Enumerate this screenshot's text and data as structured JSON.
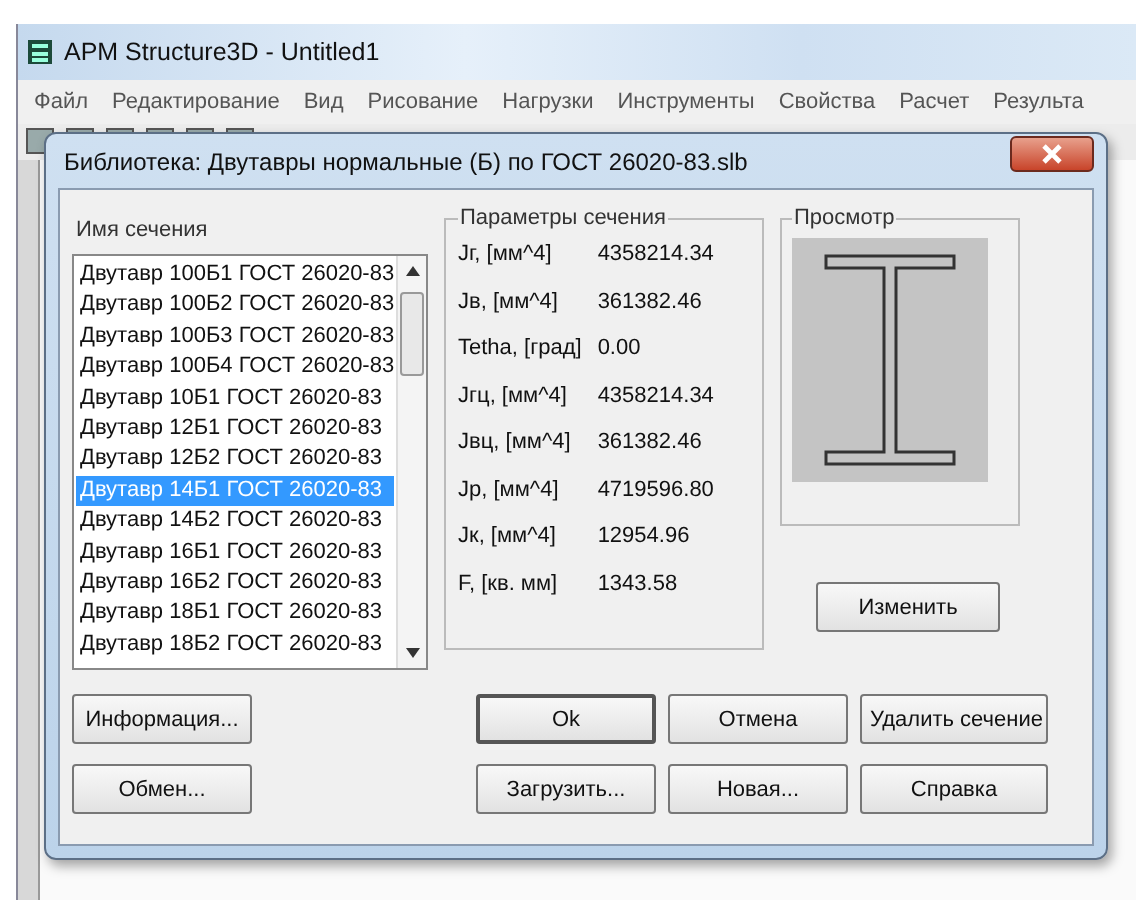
{
  "app": {
    "title": "APM Structure3D - Untitled1"
  },
  "menu": [
    "Файл",
    "Редактирование",
    "Вид",
    "Рисование",
    "Нагрузки",
    "Инструменты",
    "Свойства",
    "Расчет",
    "Результа"
  ],
  "dialog": {
    "title": "Библиотека: Двутавры нормальные (Б) по ГОСТ 26020-83.slb"
  },
  "section_list": {
    "label": "Имя сечения",
    "items": [
      {
        "label": "Двутавр 100Б1 ГОСТ 26020-83",
        "selected": false
      },
      {
        "label": "Двутавр 100Б2 ГОСТ 26020-83",
        "selected": false
      },
      {
        "label": "Двутавр 100Б3 ГОСТ 26020-83",
        "selected": false
      },
      {
        "label": "Двутавр 100Б4 ГОСТ 26020-83",
        "selected": false
      },
      {
        "label": "Двутавр 10Б1 ГОСТ 26020-83",
        "selected": false
      },
      {
        "label": "Двутавр 12Б1 ГОСТ 26020-83",
        "selected": false
      },
      {
        "label": "Двутавр 12Б2 ГОСТ 26020-83",
        "selected": false
      },
      {
        "label": "Двутавр 14Б1 ГОСТ 26020-83",
        "selected": true
      },
      {
        "label": "Двутавр 14Б2 ГОСТ 26020-83",
        "selected": false
      },
      {
        "label": "Двутавр 16Б1 ГОСТ 26020-83",
        "selected": false
      },
      {
        "label": "Двутавр 16Б2 ГОСТ 26020-83",
        "selected": false
      },
      {
        "label": "Двутавр 18Б1 ГОСТ 26020-83",
        "selected": false
      },
      {
        "label": "Двутавр 18Б2 ГОСТ 26020-83",
        "selected": false
      }
    ]
  },
  "parameters": {
    "label": "Параметры сечения",
    "rows": [
      {
        "name": "Jг, [мм^4]",
        "value": "4358214.34"
      },
      {
        "name": "Jв, [мм^4]",
        "value": "361382.46"
      },
      {
        "name": "Tetha, [град]",
        "value": "0.00"
      },
      {
        "name": "Jгц, [мм^4]",
        "value": "4358214.34"
      },
      {
        "name": "Jвц, [мм^4]",
        "value": "361382.46"
      },
      {
        "name": "Jp, [мм^4]",
        "value": "4719596.80"
      },
      {
        "name": "Jк, [мм^4]",
        "value": "12954.96"
      },
      {
        "name": "F, [кв. мм]",
        "value": "1343.58"
      }
    ]
  },
  "preview": {
    "label": "Просмотр",
    "button": "Изменить"
  },
  "buttons": [
    {
      "label": "Информация...",
      "default": false
    },
    {
      "label": "Ok",
      "default": true
    },
    {
      "label": "Отмена",
      "default": false
    },
    {
      "label": "Удалить сечение",
      "default": false
    },
    {
      "label": "Обмен...",
      "default": false
    },
    {
      "label": "Загрузить...",
      "default": false
    },
    {
      "label": "Новая...",
      "default": false
    },
    {
      "label": "Справка",
      "default": false
    }
  ]
}
